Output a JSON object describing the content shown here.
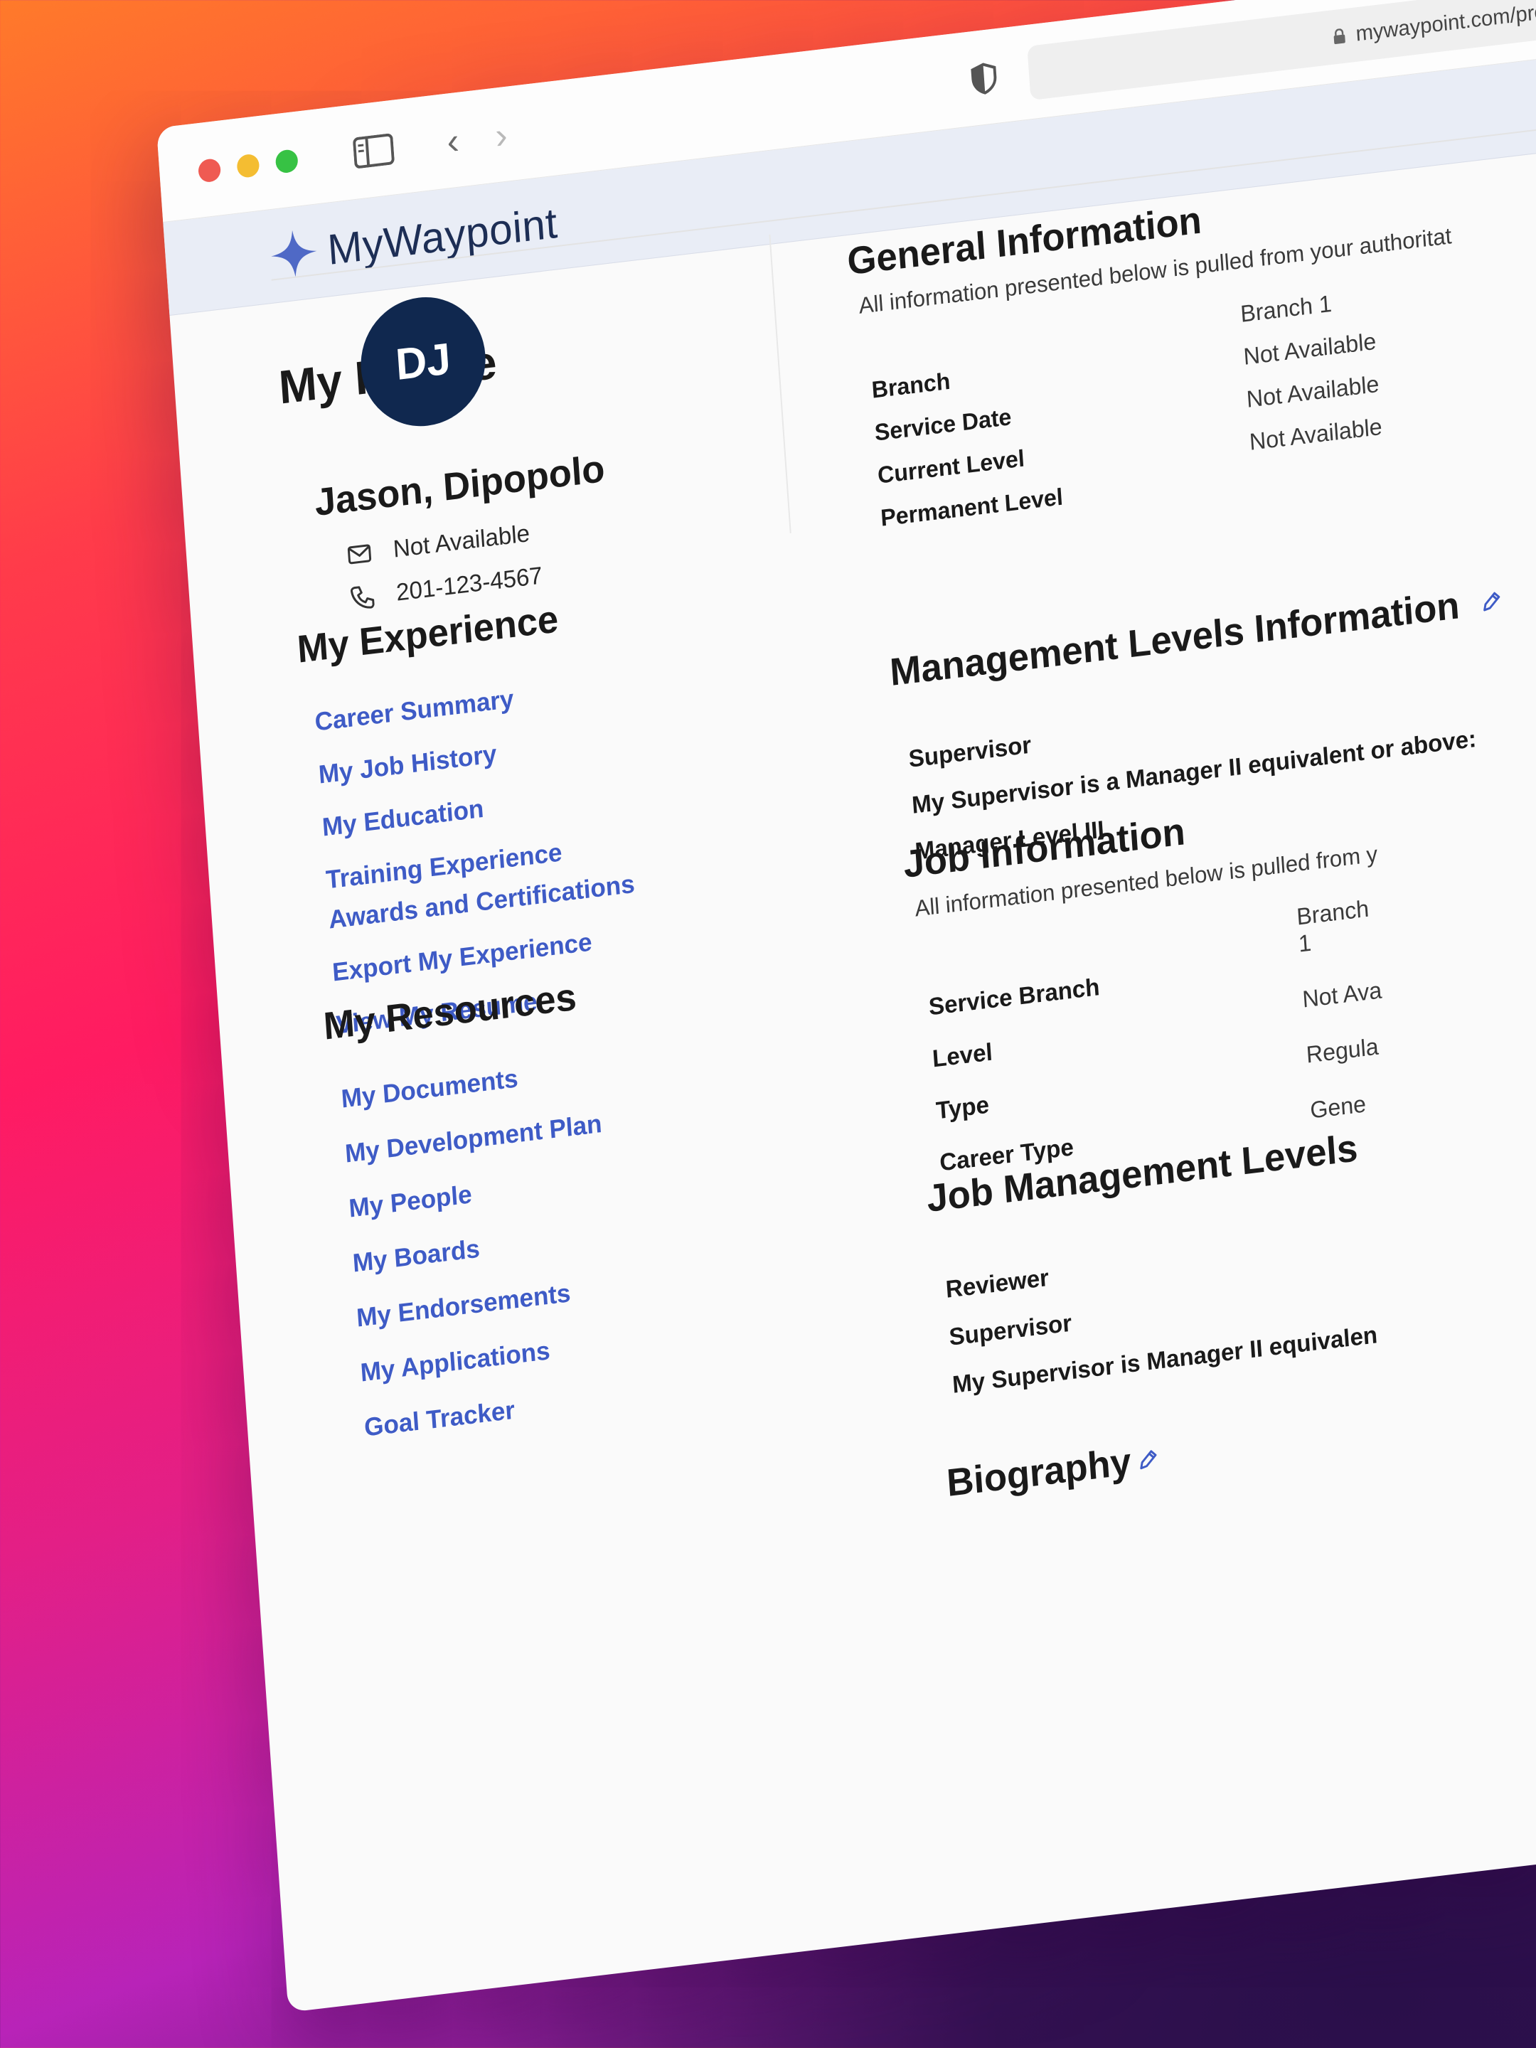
{
  "browser": {
    "url": "mywaypoint.com/pro"
  },
  "app": {
    "brand": "MyWaypoint"
  },
  "page": {
    "title": "My Profile"
  },
  "profile": {
    "initials": "DJ",
    "name": "Jason, Dipopolo",
    "email": "Not Available",
    "phone": "201-123-4567"
  },
  "experience": {
    "heading": "My Experience",
    "links": [
      "Career Summary",
      "My Job History",
      "My Education",
      "Training Experience",
      "Awards and Certifications",
      "Export My Experience",
      "View My Resume"
    ]
  },
  "resources": {
    "heading": "My Resources",
    "links": [
      "My Documents",
      "My Development Plan",
      "My People",
      "My Boards",
      "My Endorsements",
      "My Applications",
      "Goal Tracker"
    ]
  },
  "general_info": {
    "heading": "General Information",
    "note": "All information presented below is pulled from your authoritat",
    "keys": [
      "Branch",
      "Service Date",
      "Current Level",
      "Permanent Level"
    ],
    "values": [
      "Branch 1",
      "Not Available",
      "Not Available",
      "Not Available"
    ]
  },
  "management_levels": {
    "heading": "Management Levels Information",
    "rows": [
      "Supervisor",
      "My Supervisor is a Manager II equivalent or above:",
      "Manager Level III"
    ]
  },
  "job_info": {
    "heading": "Job Information",
    "note": "All information presented below is pulled from y",
    "keys": [
      "Service Branch",
      "Level",
      "Type",
      "Career Type"
    ],
    "values": [
      "Branch 1",
      "Not Ava",
      "Regula",
      "Gene"
    ]
  },
  "job_management_levels": {
    "heading": "Job Management Levels",
    "rows": [
      "Reviewer",
      "Supervisor",
      "My Supervisor is Manager II equivalen"
    ]
  },
  "biography": {
    "heading": "Biography"
  },
  "colors": {
    "link": "#3e5bc6",
    "avatar_bg": "#10284f",
    "appbar_bg": "#e9edf6",
    "brand_text": "#1d2e55"
  }
}
